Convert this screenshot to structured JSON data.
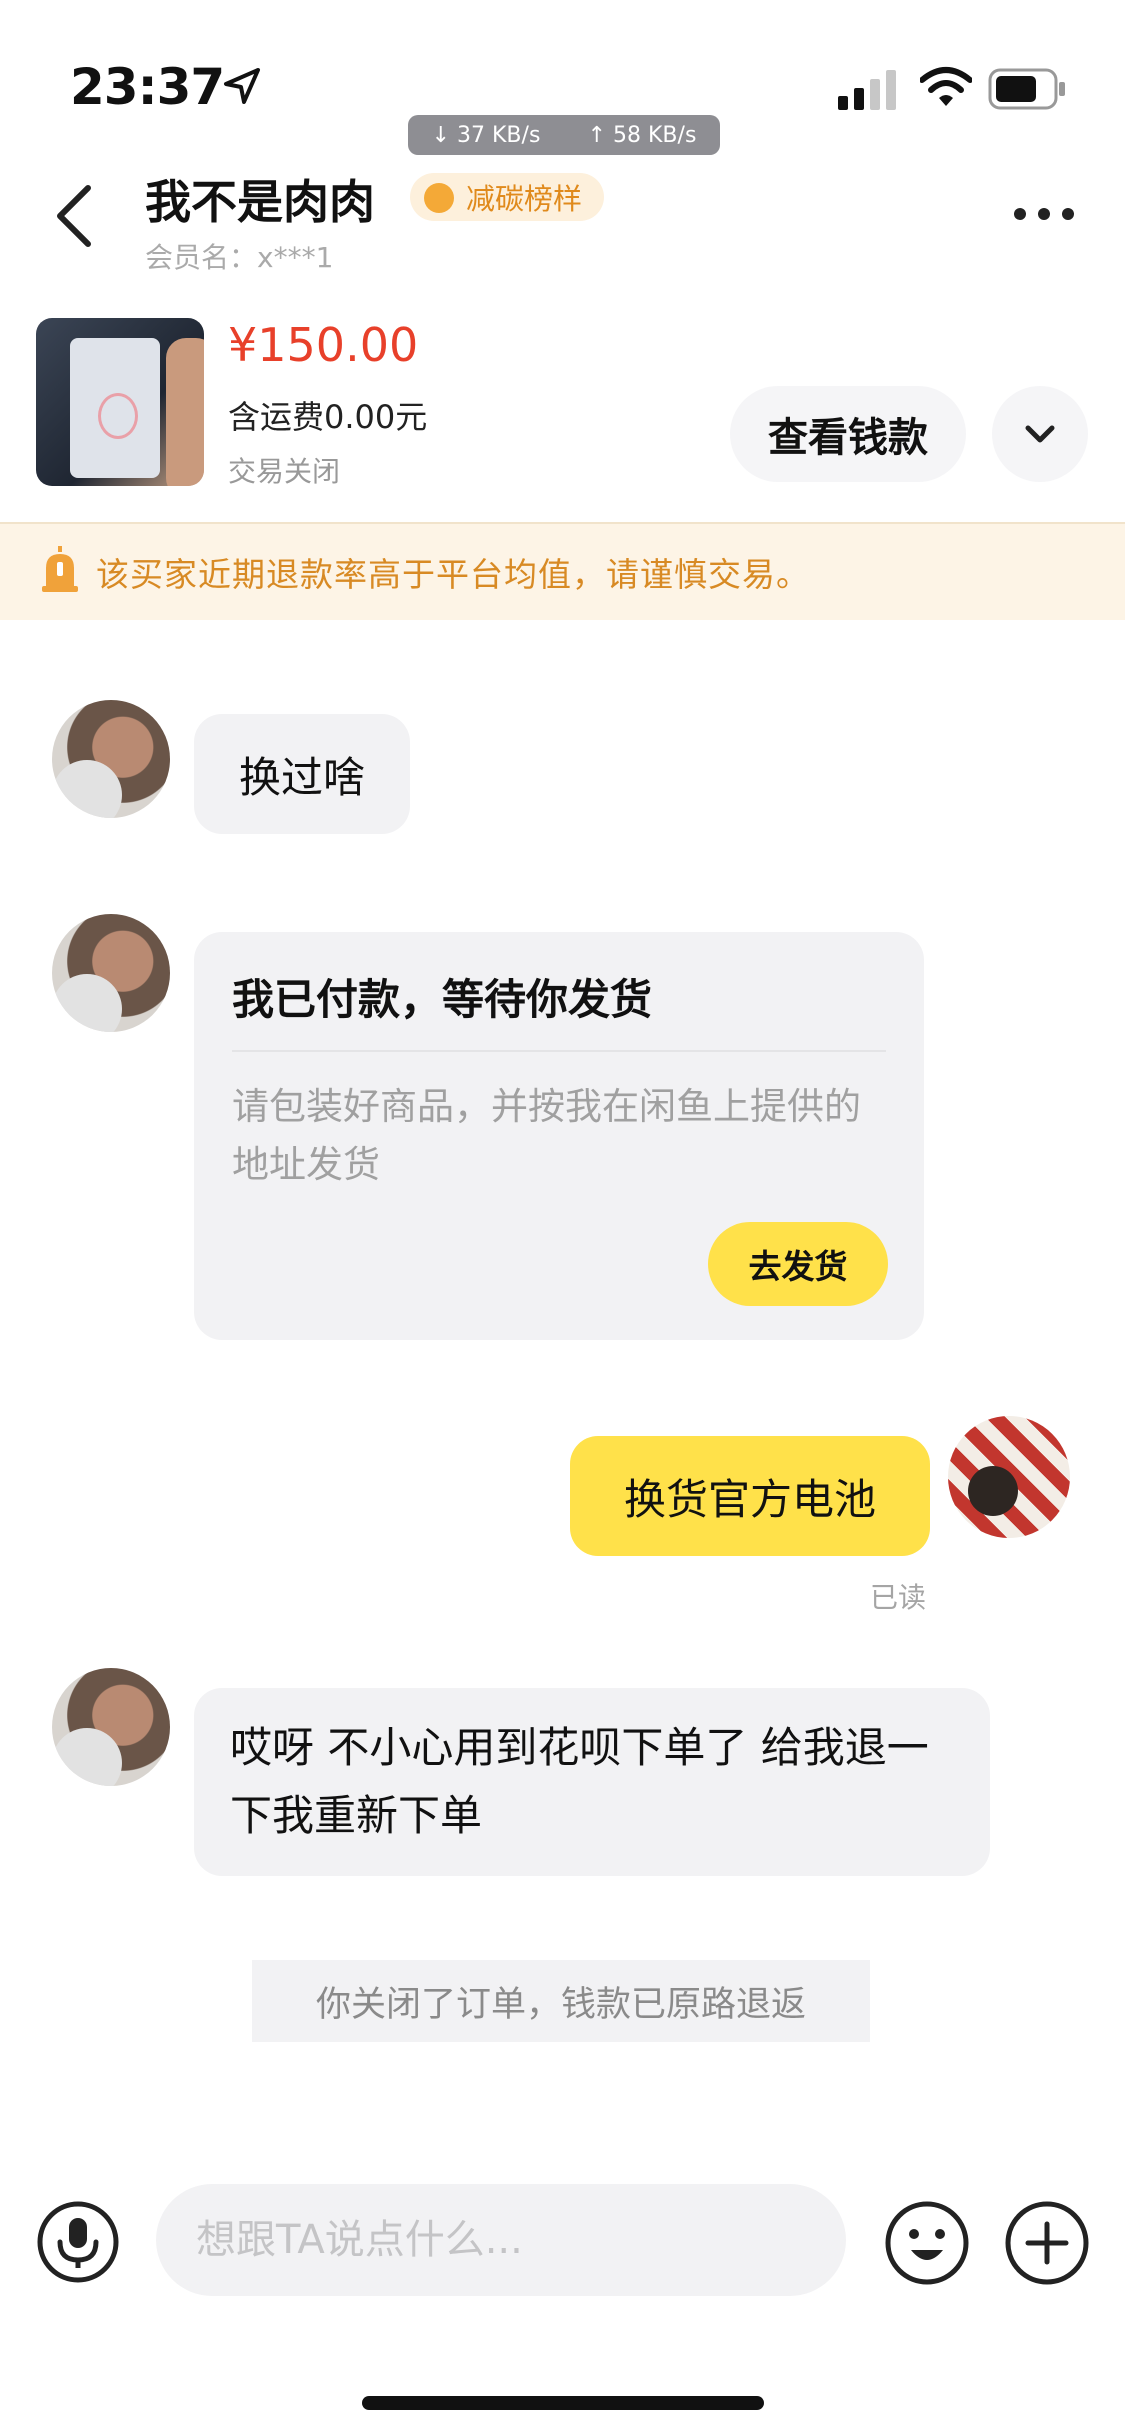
{
  "status_bar": {
    "time": "23:37",
    "download_speed": "↓ 37 KB/s",
    "upload_speed": "↑ 58 KB/s"
  },
  "header": {
    "user_name": "我不是肉肉",
    "badge_label": "减碳榜样",
    "member_label": "会员名：x***1"
  },
  "product": {
    "price": "¥150.00",
    "shipping": "含运费0.00元",
    "status": "交易关闭",
    "view_money_label": "查看钱款"
  },
  "warning": {
    "text": "该买家近期退款率高于平台均值，请谨慎交易。",
    "color": "#d88a24"
  },
  "messages": {
    "msg1": "换过啥",
    "pay_card_title": "我已付款，等待你发货",
    "pay_card_desc": "请包装好商品，并按我在闲鱼上提供的地址发货",
    "ship_button": "去发货",
    "msg3": "换货官方电池",
    "read_label": "已读",
    "msg4": "哎呀 不小心用到花呗下单了 给我退一下我重新下单",
    "system_note": "你关闭了订单，钱款已原路退返"
  },
  "input_bar": {
    "placeholder": "想跟TA说点什么..."
  },
  "colors": {
    "accent_yellow": "#ffe14a",
    "price_red": "#e8402a",
    "bubble_gray": "#f2f2f4"
  }
}
